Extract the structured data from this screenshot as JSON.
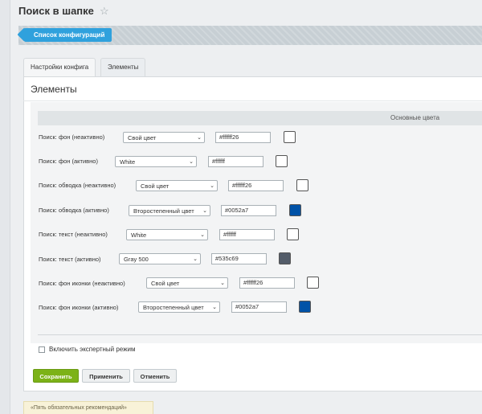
{
  "page": {
    "title": "Поиск в шапке"
  },
  "breadcrumb": {
    "back_label": "Список конфигураций"
  },
  "tabs": [
    {
      "label": "Настройки конфига"
    },
    {
      "label": "Элементы"
    }
  ],
  "panel": {
    "title": "Элементы",
    "section_title": "Основные цвета",
    "rows": [
      {
        "label": "Поиск: фон (неактивно)",
        "select": "Свой цвет",
        "value": "#ffffff26",
        "swatch_color": "#ffffff"
      },
      {
        "label": "Поиск: фон (активно)",
        "select": "White",
        "value": "#ffffff",
        "swatch_color": "#ffffff"
      },
      {
        "label": "Поиск: обводка (неактивно)",
        "select": "Свой цвет",
        "value": "#ffffff26",
        "swatch_color": "#ffffff"
      },
      {
        "label": "Поиск: обводка (активно)",
        "select": "Второстепенный цвет",
        "value": "#0052a7",
        "swatch_color": "#0052a7"
      },
      {
        "label": "Поиск: текст (неактивно)",
        "select": "White",
        "value": "#ffffff",
        "swatch_color": "#ffffff"
      },
      {
        "label": "Поиск: текст (активно)",
        "select": "Gray 500",
        "value": "#535c69",
        "swatch_color": "#535c69"
      },
      {
        "label": "Поиск: фон иконки (неактивно)",
        "select": "Свой цвет",
        "value": "#ffffff26",
        "swatch_color": "#ffffff"
      },
      {
        "label": "Поиск: фон иконки (активно)",
        "select": "Второстепенный цвет",
        "value": "#0052a7",
        "swatch_color": "#0052a7"
      }
    ],
    "expert_mode_label": "Включить экспертный режим"
  },
  "buttons": {
    "save": "Сохранить",
    "apply": "Применить",
    "cancel": "Отменить"
  },
  "bottom_note": "«Пять обязательных рекомендаций»"
}
